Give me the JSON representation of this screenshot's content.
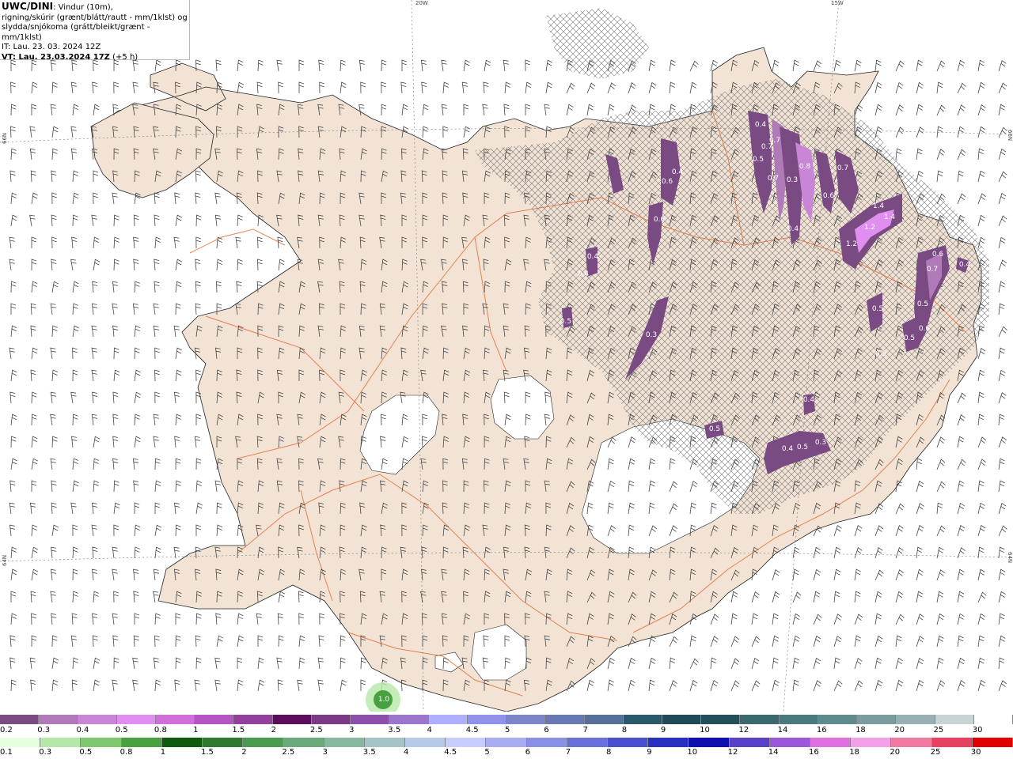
{
  "header": {
    "title_bold": "UWC/DINI",
    "title_rest": ": Vindur (10m),",
    "line2": "rigning/skúrir (grænt/blátt/rautt - mm/1klst) og",
    "line3": "slydda/snjókoma (grátt/bleikt/grænt - mm/1klst)",
    "it_line": "IT: Lau. 23. 03. 2024 12Z",
    "vt_bold": "VT: Lau. 23.03.2024 17Z",
    "vt_rest": " (+5 h)"
  },
  "graticule": {
    "lon_labels": [
      "20W",
      "15W"
    ],
    "lat_labels": [
      "66N",
      "64N",
      "66N",
      "64N"
    ]
  },
  "precip_labels": [
    "0.4",
    "0.7",
    "0.7",
    "0.5",
    "0.8",
    "0.7",
    "0.3",
    "0.7",
    "0.4",
    "0.6",
    "0.6",
    "0.4",
    "1.4",
    "1.4",
    "1.2",
    "1.2",
    "0.6",
    "0.7",
    "0.5",
    "0.5",
    "0.6",
    "0.5",
    "0.3",
    "0.4",
    "0.4",
    "0.5",
    "0.5",
    "0.4",
    "0.4",
    "0.5",
    "0.3",
    "0.5",
    "0.6",
    "0.4",
    "1.0"
  ],
  "legend_snow": {
    "labels": [
      "0.2",
      "0.3",
      "0.4",
      "0.5",
      "0.8",
      "1",
      "1.5",
      "2",
      "2.5",
      "3",
      "3.5",
      "4",
      "4.5",
      "5",
      "6",
      "7",
      "8",
      "9",
      "10",
      "12",
      "14",
      "16",
      "18",
      "20",
      "25",
      "30"
    ],
    "colors": [
      "#7a4a82",
      "#b07ab8",
      "#c985d6",
      "#e08ef0",
      "#d16fd9",
      "#b555c4",
      "#93409d",
      "#5a0d5a",
      "#7a3a88",
      "#8c4faa",
      "#9b76cc",
      "#aeb0ff",
      "#8f92e8",
      "#7b86c8",
      "#6878b0",
      "#56709a",
      "#2a5a6a",
      "#1f4a58",
      "#244e58",
      "#3a6a70",
      "#4a7a80",
      "#5f8a8e",
      "#7a9ca0",
      "#98b0b2",
      "#c8d4d4",
      "#ffffff"
    ]
  },
  "legend_rain": {
    "labels": [
      "0.1",
      "0.3",
      "0.5",
      "0.8",
      "1",
      "1.5",
      "2",
      "2.5",
      "3",
      "3.5",
      "4",
      "4.5",
      "5",
      "6",
      "7",
      "8",
      "9",
      "10",
      "12",
      "14",
      "16",
      "18",
      "20",
      "25",
      "30"
    ],
    "colors": [
      "#e6ffe0",
      "#b5e8a8",
      "#7fc870",
      "#48a040",
      "#0e5a0e",
      "#2e7a30",
      "#4a9a50",
      "#6aaa7a",
      "#88b8a0",
      "#a6c4c8",
      "#b8c8e8",
      "#c8ccff",
      "#a8acf0",
      "#8890e8",
      "#6870dc",
      "#4850d0",
      "#2830c4",
      "#1010b0",
      "#5a40c8",
      "#9a58d8",
      "#e070e0",
      "#f4a0e8",
      "#f07aa0",
      "#e84060",
      "#e00000"
    ]
  }
}
